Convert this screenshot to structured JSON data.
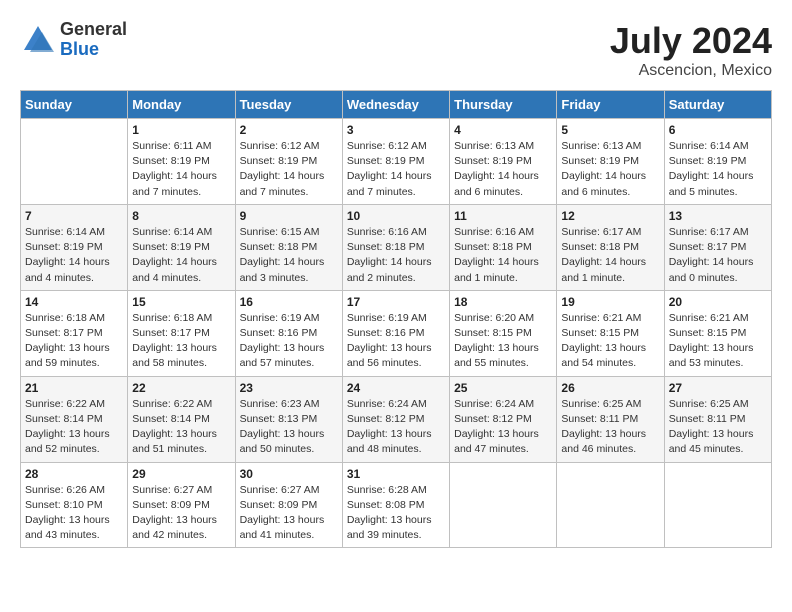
{
  "logo": {
    "general": "General",
    "blue": "Blue"
  },
  "title": {
    "month_year": "July 2024",
    "location": "Ascencion, Mexico"
  },
  "calendar": {
    "headers": [
      "Sunday",
      "Monday",
      "Tuesday",
      "Wednesday",
      "Thursday",
      "Friday",
      "Saturday"
    ],
    "weeks": [
      [
        {
          "day": "",
          "sunrise": "",
          "sunset": "",
          "daylight": ""
        },
        {
          "day": "1",
          "sunrise": "Sunrise: 6:11 AM",
          "sunset": "Sunset: 8:19 PM",
          "daylight": "Daylight: 14 hours and 7 minutes."
        },
        {
          "day": "2",
          "sunrise": "Sunrise: 6:12 AM",
          "sunset": "Sunset: 8:19 PM",
          "daylight": "Daylight: 14 hours and 7 minutes."
        },
        {
          "day": "3",
          "sunrise": "Sunrise: 6:12 AM",
          "sunset": "Sunset: 8:19 PM",
          "daylight": "Daylight: 14 hours and 7 minutes."
        },
        {
          "day": "4",
          "sunrise": "Sunrise: 6:13 AM",
          "sunset": "Sunset: 8:19 PM",
          "daylight": "Daylight: 14 hours and 6 minutes."
        },
        {
          "day": "5",
          "sunrise": "Sunrise: 6:13 AM",
          "sunset": "Sunset: 8:19 PM",
          "daylight": "Daylight: 14 hours and 6 minutes."
        },
        {
          "day": "6",
          "sunrise": "Sunrise: 6:14 AM",
          "sunset": "Sunset: 8:19 PM",
          "daylight": "Daylight: 14 hours and 5 minutes."
        }
      ],
      [
        {
          "day": "7",
          "sunrise": "Sunrise: 6:14 AM",
          "sunset": "Sunset: 8:19 PM",
          "daylight": "Daylight: 14 hours and 4 minutes."
        },
        {
          "day": "8",
          "sunrise": "Sunrise: 6:14 AM",
          "sunset": "Sunset: 8:19 PM",
          "daylight": "Daylight: 14 hours and 4 minutes."
        },
        {
          "day": "9",
          "sunrise": "Sunrise: 6:15 AM",
          "sunset": "Sunset: 8:18 PM",
          "daylight": "Daylight: 14 hours and 3 minutes."
        },
        {
          "day": "10",
          "sunrise": "Sunrise: 6:16 AM",
          "sunset": "Sunset: 8:18 PM",
          "daylight": "Daylight: 14 hours and 2 minutes."
        },
        {
          "day": "11",
          "sunrise": "Sunrise: 6:16 AM",
          "sunset": "Sunset: 8:18 PM",
          "daylight": "Daylight: 14 hours and 1 minute."
        },
        {
          "day": "12",
          "sunrise": "Sunrise: 6:17 AM",
          "sunset": "Sunset: 8:18 PM",
          "daylight": "Daylight: 14 hours and 1 minute."
        },
        {
          "day": "13",
          "sunrise": "Sunrise: 6:17 AM",
          "sunset": "Sunset: 8:17 PM",
          "daylight": "Daylight: 14 hours and 0 minutes."
        }
      ],
      [
        {
          "day": "14",
          "sunrise": "Sunrise: 6:18 AM",
          "sunset": "Sunset: 8:17 PM",
          "daylight": "Daylight: 13 hours and 59 minutes."
        },
        {
          "day": "15",
          "sunrise": "Sunrise: 6:18 AM",
          "sunset": "Sunset: 8:17 PM",
          "daylight": "Daylight: 13 hours and 58 minutes."
        },
        {
          "day": "16",
          "sunrise": "Sunrise: 6:19 AM",
          "sunset": "Sunset: 8:16 PM",
          "daylight": "Daylight: 13 hours and 57 minutes."
        },
        {
          "day": "17",
          "sunrise": "Sunrise: 6:19 AM",
          "sunset": "Sunset: 8:16 PM",
          "daylight": "Daylight: 13 hours and 56 minutes."
        },
        {
          "day": "18",
          "sunrise": "Sunrise: 6:20 AM",
          "sunset": "Sunset: 8:15 PM",
          "daylight": "Daylight: 13 hours and 55 minutes."
        },
        {
          "day": "19",
          "sunrise": "Sunrise: 6:21 AM",
          "sunset": "Sunset: 8:15 PM",
          "daylight": "Daylight: 13 hours and 54 minutes."
        },
        {
          "day": "20",
          "sunrise": "Sunrise: 6:21 AM",
          "sunset": "Sunset: 8:15 PM",
          "daylight": "Daylight: 13 hours and 53 minutes."
        }
      ],
      [
        {
          "day": "21",
          "sunrise": "Sunrise: 6:22 AM",
          "sunset": "Sunset: 8:14 PM",
          "daylight": "Daylight: 13 hours and 52 minutes."
        },
        {
          "day": "22",
          "sunrise": "Sunrise: 6:22 AM",
          "sunset": "Sunset: 8:14 PM",
          "daylight": "Daylight: 13 hours and 51 minutes."
        },
        {
          "day": "23",
          "sunrise": "Sunrise: 6:23 AM",
          "sunset": "Sunset: 8:13 PM",
          "daylight": "Daylight: 13 hours and 50 minutes."
        },
        {
          "day": "24",
          "sunrise": "Sunrise: 6:24 AM",
          "sunset": "Sunset: 8:12 PM",
          "daylight": "Daylight: 13 hours and 48 minutes."
        },
        {
          "day": "25",
          "sunrise": "Sunrise: 6:24 AM",
          "sunset": "Sunset: 8:12 PM",
          "daylight": "Daylight: 13 hours and 47 minutes."
        },
        {
          "day": "26",
          "sunrise": "Sunrise: 6:25 AM",
          "sunset": "Sunset: 8:11 PM",
          "daylight": "Daylight: 13 hours and 46 minutes."
        },
        {
          "day": "27",
          "sunrise": "Sunrise: 6:25 AM",
          "sunset": "Sunset: 8:11 PM",
          "daylight": "Daylight: 13 hours and 45 minutes."
        }
      ],
      [
        {
          "day": "28",
          "sunrise": "Sunrise: 6:26 AM",
          "sunset": "Sunset: 8:10 PM",
          "daylight": "Daylight: 13 hours and 43 minutes."
        },
        {
          "day": "29",
          "sunrise": "Sunrise: 6:27 AM",
          "sunset": "Sunset: 8:09 PM",
          "daylight": "Daylight: 13 hours and 42 minutes."
        },
        {
          "day": "30",
          "sunrise": "Sunrise: 6:27 AM",
          "sunset": "Sunset: 8:09 PM",
          "daylight": "Daylight: 13 hours and 41 minutes."
        },
        {
          "day": "31",
          "sunrise": "Sunrise: 6:28 AM",
          "sunset": "Sunset: 8:08 PM",
          "daylight": "Daylight: 13 hours and 39 minutes."
        },
        {
          "day": "",
          "sunrise": "",
          "sunset": "",
          "daylight": ""
        },
        {
          "day": "",
          "sunrise": "",
          "sunset": "",
          "daylight": ""
        },
        {
          "day": "",
          "sunrise": "",
          "sunset": "",
          "daylight": ""
        }
      ]
    ]
  }
}
